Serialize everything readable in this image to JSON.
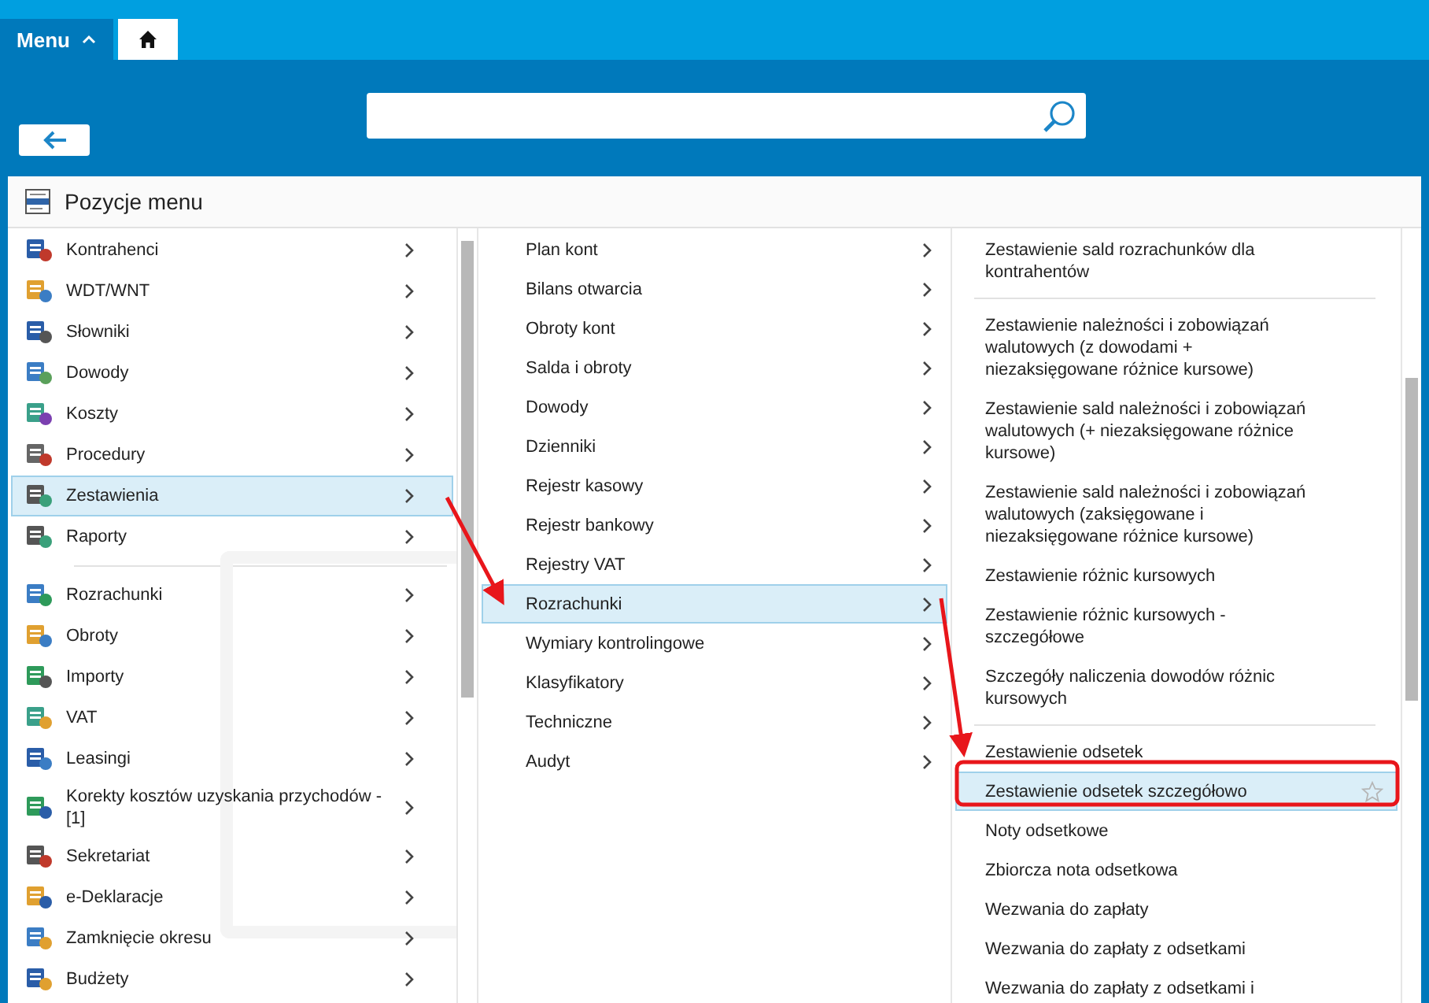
{
  "top_bar": {
    "menu_tab": {
      "label": "Menu",
      "expanded": true
    }
  },
  "panel": {
    "title": "Pozycje menu"
  },
  "columns": [
    {
      "groups": [
        [
          {
            "label": "Kontrahenci",
            "selected": false,
            "submenu": true
          },
          {
            "label": "WDT/WNT",
            "selected": false,
            "submenu": true
          },
          {
            "label": "Słowniki",
            "selected": false,
            "submenu": true
          },
          {
            "label": "Dowody",
            "selected": false,
            "submenu": true
          },
          {
            "label": "Koszty",
            "selected": false,
            "submenu": true
          },
          {
            "label": "Procedury",
            "selected": false,
            "submenu": true
          },
          {
            "label": "Zestawienia",
            "selected": true,
            "submenu": true
          },
          {
            "label": "Raporty",
            "selected": false,
            "submenu": true
          }
        ],
        [
          {
            "label": "Rozrachunki",
            "selected": false,
            "submenu": true
          },
          {
            "label": "Obroty",
            "selected": false,
            "submenu": true
          },
          {
            "label": "Importy",
            "selected": false,
            "submenu": true
          },
          {
            "label": "VAT",
            "selected": false,
            "submenu": true
          },
          {
            "label": "Leasingi",
            "selected": false,
            "submenu": true
          },
          {
            "label": "Korekty kosztów uzyskania przychodów - [1]",
            "selected": false,
            "submenu": true
          },
          {
            "label": "Sekretariat",
            "selected": false,
            "submenu": true
          },
          {
            "label": "e-Deklaracje",
            "selected": false,
            "submenu": true
          },
          {
            "label": "Zamknięcie okresu",
            "selected": false,
            "submenu": true
          },
          {
            "label": "Budżety",
            "selected": false,
            "submenu": true
          }
        ]
      ]
    },
    {
      "groups": [
        [
          {
            "label": "Plan kont",
            "selected": false,
            "submenu": true
          },
          {
            "label": "Bilans otwarcia",
            "selected": false,
            "submenu": true
          },
          {
            "label": "Obroty kont",
            "selected": false,
            "submenu": true
          },
          {
            "label": "Salda i obroty",
            "selected": false,
            "submenu": true
          },
          {
            "label": "Dowody",
            "selected": false,
            "submenu": true
          },
          {
            "label": "Dzienniki",
            "selected": false,
            "submenu": true
          },
          {
            "label": "Rejestr kasowy",
            "selected": false,
            "submenu": true
          },
          {
            "label": "Rejestr bankowy",
            "selected": false,
            "submenu": true
          },
          {
            "label": "Rejestry VAT",
            "selected": false,
            "submenu": true
          },
          {
            "label": "Rozrachunki",
            "selected": true,
            "submenu": true
          },
          {
            "label": "Wymiary kontrolingowe",
            "selected": false,
            "submenu": true
          },
          {
            "label": "Klasyfikatory",
            "selected": false,
            "submenu": true
          },
          {
            "label": "Techniczne",
            "selected": false,
            "submenu": true
          },
          {
            "label": "Audyt",
            "selected": false,
            "submenu": true
          }
        ]
      ]
    },
    {
      "groups": [
        [
          {
            "label": "Zestawienie sald rozrachunków dla kontrahentów",
            "selected": false,
            "submenu": false
          }
        ],
        [
          {
            "label": "Zestawienie należności i zobowiązań walutowych (z dowodami + niezaksięgowane różnice kursowe)",
            "selected": false,
            "submenu": false
          },
          {
            "label": "Zestawienie sald należności i zobowiązań walutowych (+ niezaksięgowane różnice kursowe)",
            "selected": false,
            "submenu": false
          },
          {
            "label": "Zestawienie sald należności i zobowiązań walutowych (zaksięgowane i niezaksięgowane różnice kursowe)",
            "selected": false,
            "submenu": false
          },
          {
            "label": "Zestawienie różnic kursowych",
            "selected": false,
            "submenu": false
          },
          {
            "label": "Zestawienie różnic kursowych - szczegółowe",
            "selected": false,
            "submenu": false
          },
          {
            "label": "Szczegóły naliczenia dowodów różnic kursowych",
            "selected": false,
            "submenu": false
          }
        ],
        [
          {
            "label": "Zestawienie odsetek",
            "selected": false,
            "submenu": false
          },
          {
            "label": "Zestawienie odsetek szczegółowo",
            "selected": true,
            "submenu": false
          },
          {
            "label": "Noty odsetkowe",
            "selected": false,
            "submenu": false
          },
          {
            "label": "Zbiorcza nota odsetkowa",
            "selected": false,
            "submenu": false
          },
          {
            "label": "Wezwania do zapłaty",
            "selected": false,
            "submenu": false
          },
          {
            "label": "Wezwania do zapłaty z odsetkami",
            "selected": false,
            "submenu": false
          },
          {
            "label": "Wezwania do zapłaty z odsetkami i",
            "selected": false,
            "submenu": false
          }
        ]
      ]
    }
  ]
}
